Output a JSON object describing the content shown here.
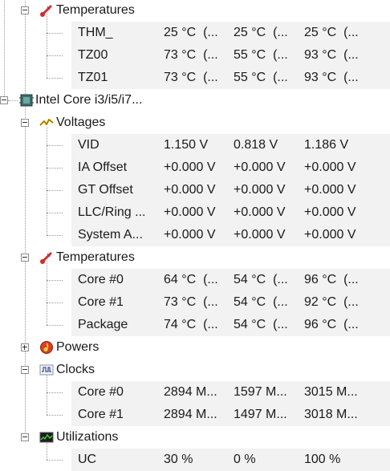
{
  "rows": [
    {
      "level": 1,
      "label": "Temperatures",
      "icon": "thermometer-icon",
      "expander": "minus",
      "values": []
    },
    {
      "level": 2,
      "label": "THM_",
      "values": [
        "25 °C  (...",
        "25 °C  (...",
        "25 °C  (..."
      ]
    },
    {
      "level": 2,
      "label": "TZ00",
      "values": [
        "73 °C  (...",
        "55 °C  (...",
        "93 °C  (..."
      ]
    },
    {
      "level": 2,
      "label": "TZ01",
      "values": [
        "73 °C  (...",
        "55 °C  (...",
        "93 °C  (..."
      ]
    },
    {
      "level": 0,
      "label": "Intel Core i3/i5/i7...",
      "icon": "cpu-chip-icon",
      "expander": "minus",
      "values": []
    },
    {
      "level": 1,
      "label": "Voltages",
      "icon": "voltage-bolt-icon",
      "expander": "minus",
      "values": []
    },
    {
      "level": 2,
      "label": "VID",
      "values": [
        "1.150 V",
        "0.818 V",
        "1.186 V"
      ]
    },
    {
      "level": 2,
      "label": "IA Offset",
      "values": [
        "+0.000 V",
        "+0.000 V",
        "+0.000 V"
      ]
    },
    {
      "level": 2,
      "label": "GT Offset",
      "values": [
        "+0.000 V",
        "+0.000 V",
        "+0.000 V"
      ]
    },
    {
      "level": 2,
      "label": "LLC/Ring ...",
      "values": [
        "+0.000 V",
        "+0.000 V",
        "+0.000 V"
      ]
    },
    {
      "level": 2,
      "label": "System A...",
      "values": [
        "+0.000 V",
        "+0.000 V",
        "+0.000 V"
      ]
    },
    {
      "level": 1,
      "label": "Temperatures",
      "icon": "thermometer-icon",
      "expander": "minus",
      "values": []
    },
    {
      "level": 2,
      "label": "Core #0",
      "values": [
        "64 °C  (...",
        "54 °C  (...",
        "96 °C  (..."
      ]
    },
    {
      "level": 2,
      "label": "Core #1",
      "values": [
        "73 °C  (...",
        "54 °C  (...",
        "92 °C  (..."
      ]
    },
    {
      "level": 2,
      "label": "Package",
      "values": [
        "74 °C  (...",
        "54 °C  (...",
        "96 °C  (..."
      ]
    },
    {
      "level": 1,
      "label": "Powers",
      "icon": "power-flame-icon",
      "expander": "plus",
      "values": []
    },
    {
      "level": 1,
      "label": "Clocks",
      "icon": "clock-wave-icon",
      "expander": "minus",
      "values": []
    },
    {
      "level": 2,
      "label": "Core #0",
      "values": [
        "2894 M...",
        "1597 M...",
        "3015 M..."
      ]
    },
    {
      "level": 2,
      "label": "Core #1",
      "values": [
        "2894 M...",
        "1497 M...",
        "3018 M..."
      ]
    },
    {
      "level": 1,
      "label": "Utilizations",
      "icon": "utilization-monitor-icon",
      "expander": "minus",
      "values": []
    },
    {
      "level": 2,
      "label": "UC",
      "values": [
        "30 %",
        "0 %",
        "100 %"
      ]
    }
  ]
}
